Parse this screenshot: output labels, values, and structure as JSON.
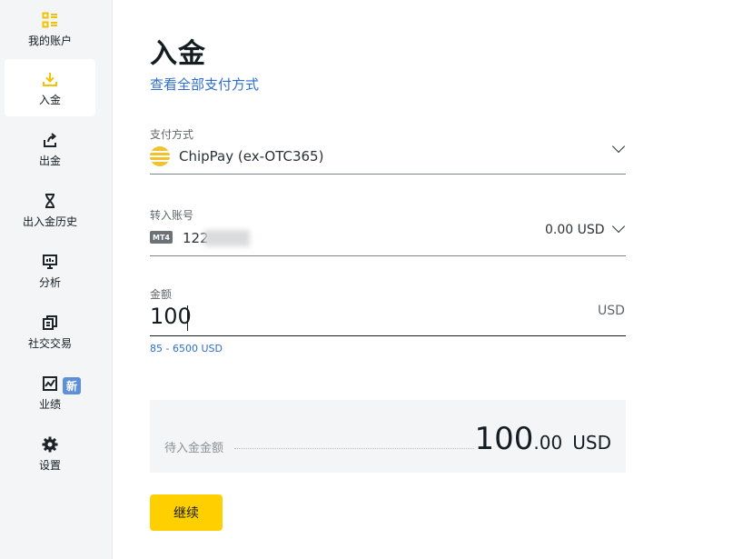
{
  "sidebar": {
    "items": [
      {
        "label": "我的账户",
        "icon": "grid-list-icon"
      },
      {
        "label": "入金",
        "icon": "download-icon"
      },
      {
        "label": "出金",
        "icon": "upload-icon"
      },
      {
        "label": "出入金历史",
        "icon": "hourglass-icon"
      },
      {
        "label": "分析",
        "icon": "presentation-chart-icon"
      },
      {
        "label": "社交交易",
        "icon": "copy-icon"
      },
      {
        "label": "业绩",
        "icon": "line-chart-icon"
      },
      {
        "label": "设置",
        "icon": "gear-icon"
      }
    ],
    "new_badge": "新",
    "accent_color": "#ffcf00"
  },
  "page": {
    "title": "入金",
    "link": "查看全部支付方式"
  },
  "payment": {
    "label": "支付方式",
    "value": "ChipPay (ex-OTC365)"
  },
  "account": {
    "label": "转入账号",
    "platform_badge": "MT4",
    "number_visible": "122",
    "balance": "0.00 USD"
  },
  "amount": {
    "label": "金额",
    "value": "100",
    "currency": "USD",
    "range": "85 - 6500 USD"
  },
  "summary": {
    "label": "待入金金额",
    "amount_int": "100",
    "amount_dec": ".00",
    "currency": "USD"
  },
  "actions": {
    "continue_label": "继续"
  }
}
